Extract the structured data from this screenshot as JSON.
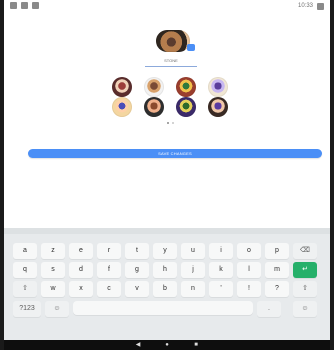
{
  "app": {
    "status_time": "10:33"
  },
  "profile": {
    "name_value": "STONE"
  },
  "actions": {
    "save_label": "SAVE CHANGES"
  },
  "keyboard": {
    "row1": [
      "a",
      "z",
      "e",
      "r",
      "t",
      "y",
      "u",
      "i",
      "o",
      "p",
      "⌫"
    ],
    "row2": [
      "q",
      "s",
      "d",
      "f",
      "g",
      "h",
      "j",
      "k",
      "l",
      "m",
      "↵"
    ],
    "row3": [
      "⇧",
      "w",
      "x",
      "c",
      "v",
      "b",
      "n",
      "'",
      "!",
      "?",
      "⇧"
    ],
    "row4": [
      "?123",
      "☺",
      "",
      ".",
      "☺"
    ]
  },
  "colors": {
    "accent_blue": "#4b8ff6",
    "enter_green": "#26b06a"
  },
  "icons": {
    "status_left": [
      "app-icon",
      "notification-icon",
      "camera-icon"
    ],
    "status_right": [
      "battery-icon"
    ],
    "nav": [
      "back-icon",
      "home-icon",
      "recents-icon"
    ]
  }
}
